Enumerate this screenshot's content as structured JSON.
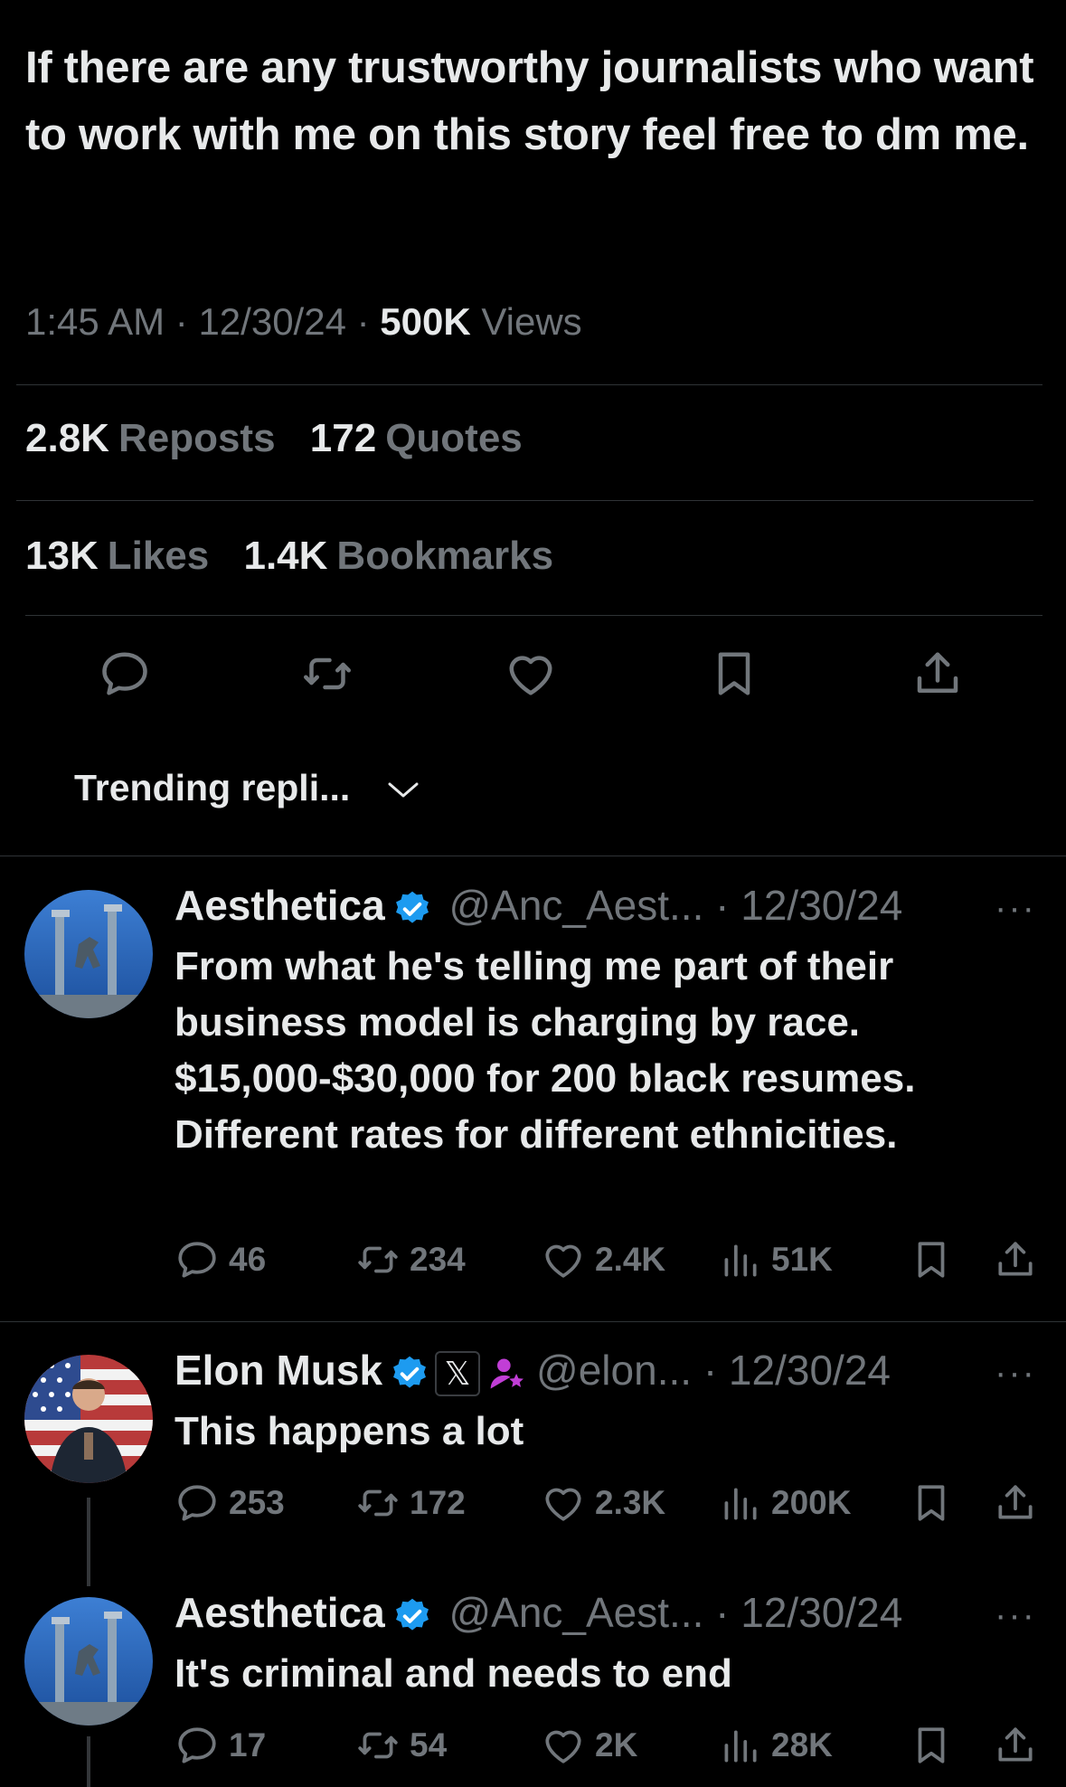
{
  "tweet": {
    "text": "If there are any trustworthy journalists who want to work with me on this story feel free to dm me.",
    "time": "1:45 AM",
    "date": "12/30/24",
    "sep": "·",
    "views_count": "500K",
    "views_label": "Views"
  },
  "stats": {
    "reposts_count": "2.8K",
    "reposts_label": "Reposts",
    "quotes_count": "172",
    "quotes_label": "Quotes",
    "likes_count": "13K",
    "likes_label": "Likes",
    "bookmarks_count": "1.4K",
    "bookmarks_label": "Bookmarks"
  },
  "sort": {
    "label": "Trending repli..."
  },
  "replies": [
    {
      "name": "Aesthetica",
      "handle": "@Anc_Aest...",
      "date": "· 12/30/24",
      "text": "From what he's telling me part of their business model is charging by race. $15,000-$30,000 for 200 black resumes. Different rates for different ethnicities.",
      "replies": "46",
      "reposts": "234",
      "likes": "2.4K",
      "views": "51K"
    },
    {
      "name": "Elon Musk",
      "handle": "@elon...",
      "date": "· 12/30/24",
      "text": "This happens a lot",
      "replies": "253",
      "reposts": "172",
      "likes": "2.3K",
      "views": "200K",
      "badge": "𝕏"
    },
    {
      "name": "Aesthetica",
      "handle": "@Anc_Aest...",
      "date": "· 12/30/24",
      "text": "It's criminal and needs to end",
      "replies": "17",
      "reposts": "54",
      "likes": "2K",
      "views": "28K"
    }
  ],
  "more_label": "···",
  "colors": {
    "background": "#000000",
    "text": "#e7e9ea",
    "muted": "#71767b",
    "verified": "#1d9bf0",
    "divider": "#2f3336"
  },
  "icons": [
    "reply-icon",
    "repost-icon",
    "like-icon",
    "bookmark-icon",
    "share-icon",
    "views-icon",
    "verified-icon",
    "chevron-down-icon",
    "more-icon"
  ]
}
